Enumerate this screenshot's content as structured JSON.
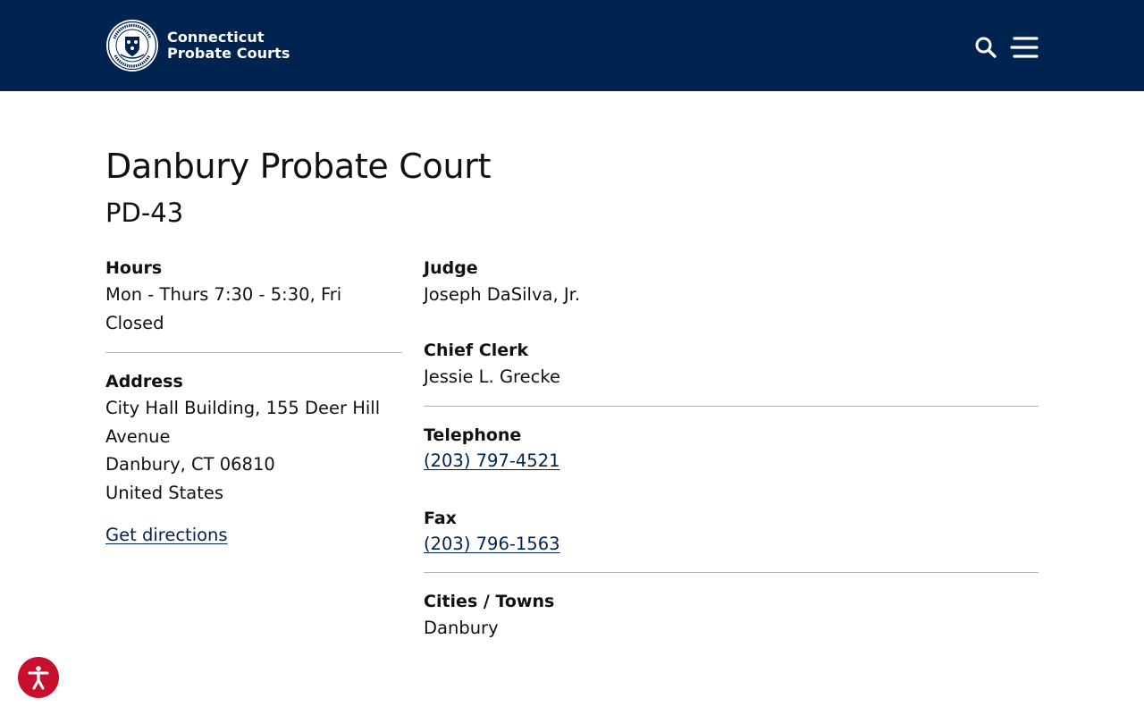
{
  "header": {
    "brand_line1": "Connecticut",
    "brand_line2": "Probate Courts",
    "logo_icon": "court-seal-icon",
    "search_icon": "search-icon",
    "menu_icon": "hamburger-menu-icon",
    "background_color": "#002350"
  },
  "court": {
    "name": "Danbury Probate Court",
    "code": "PD-43"
  },
  "hours": {
    "label": "Hours",
    "line1": "Mon - Thurs 7:30 - 5:30, Fri",
    "line2": "Closed"
  },
  "address": {
    "label": "Address",
    "line1": "City Hall Building, 155 Deer Hill",
    "line2": "Avenue",
    "line3": "Danbury, CT 06810",
    "line4": "United States",
    "directions_label": "Get directions"
  },
  "judge": {
    "label": "Judge",
    "value": "Joseph DaSilva, Jr."
  },
  "chief_clerk": {
    "label": "Chief Clerk",
    "value": "Jessie L. Grecke"
  },
  "telephone": {
    "label": "Telephone",
    "value": "(203) 797-4521"
  },
  "fax": {
    "label": "Fax",
    "value": "(203) 796-1563"
  },
  "towns": {
    "label": "Cities / Towns",
    "value": "Danbury"
  },
  "accessibility": {
    "icon": "accessibility-icon",
    "color": "#c8102e"
  },
  "colors": {
    "link": "#002350",
    "text": "#111111",
    "divider": "#b3b3b3"
  }
}
